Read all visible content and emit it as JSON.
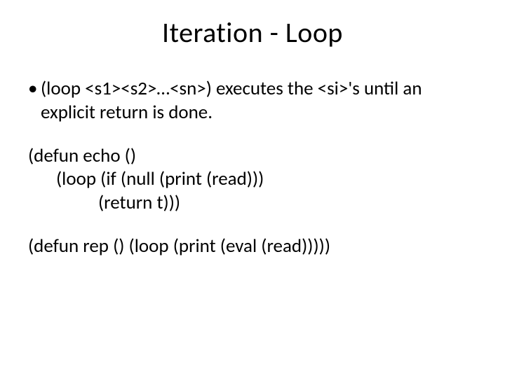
{
  "title": "Iteration - Loop",
  "bullet": {
    "dot": "•",
    "text": "(loop <s1><s2>…<sn>) executes the <si>'s until an explicit return is done."
  },
  "code1": {
    "l1": "(defun echo ()",
    "l2": "(loop (if (null (print (read)))",
    "l3": "(return t)))"
  },
  "code2": {
    "l1": "(defun rep () (loop (print (eval (read)))))"
  }
}
